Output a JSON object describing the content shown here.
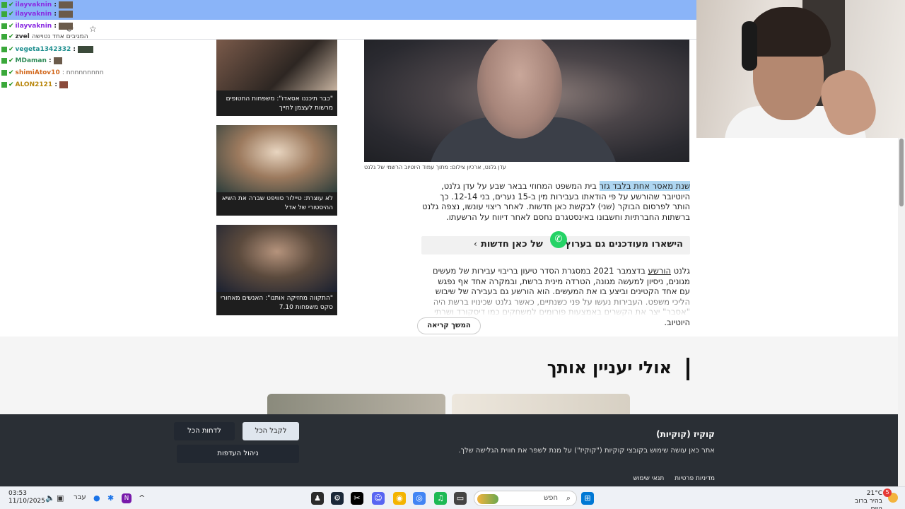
{
  "chat": {
    "messages": [
      {
        "user": "ilayvaknin",
        "text": ":",
        "color": "#8a2be2"
      },
      {
        "user": "ilayvaknin",
        "text": ":",
        "color": "#8a2be2"
      },
      {
        "user": "ilayvaknin",
        "text": ":",
        "color": "#8a2be2"
      },
      {
        "user": "zvel",
        "text": "המגיבים אחד נטוישה",
        "color": "#333333"
      },
      {
        "user": "vegeta1342332",
        "text": ":",
        "color": "#1e8f8f"
      },
      {
        "user": "MDaman",
        "text": ":",
        "color": "#2e8b57"
      },
      {
        "user": "shimiAtov10",
        "text": ": חחחחחחחחח",
        "color": "#d2691e"
      },
      {
        "user": "ALON2121",
        "text": ":",
        "color": "#b8860b"
      }
    ]
  },
  "browser": {
    "star_icon": "star-icon",
    "extensions_icon": "puzzle-icon"
  },
  "sidebar_cards": [
    {
      "caption": "\"כבר תיכננו אסאדו\": משפחות החטופים מרשות לעצמן לחייך"
    },
    {
      "caption": "לא עוצרת: טיילור סוויפט שברה את השיא ההיסטורי של אדל"
    },
    {
      "caption": "\"התקווה מחזיקה אותנו\": האנשים מאחורי סקס משפחות 7.10"
    }
  ],
  "article": {
    "credit": "עדן גלנט, ארכיון צילום: מתוך עמוד היוטיוב הרשמי של גלנט",
    "p1_highlight": "שנת מאסר אחת בלבד גזר",
    "p1_rest": " בית המשפט המחוזי בבאר שבע על עדן גלנט, היוטיובר שהורשע על פי הודאתו בעבירות מין ב-15 נערים, בני 12-14. כך הותר לפרסום הבוקר (שני) לבקשת כאן חדשות. לאחר ריצוי עונשו, נצפה גלנט ברשתות החברתיות וחשבונו באינסטגרם נחסם לאחר דיווח על הרשעתו.",
    "whatsapp_text": "הישארו מעודכנים גם בערוץ",
    "whatsapp_channel": "של כאן חדשות",
    "p2_start": "גלנט ",
    "p2_link": "הורשע",
    "p2_rest": " בדצמבר 2021 במסגרת הסדר טיעון בריבוי עבירות של מעשים מגונים, ניסיון למעשה מגונה, הטרדה מינית ברשת, ובמקרה אחד אף נפגש עם אחד הקטינים וביצע בו את המעשים. הוא הורשע גם בעבירה של שיבוש הליכי משפט. העבירות נעשו על פני כשנתיים, כאשר גלנט שכינויו ברשת היה \"אסבר\" יצר את הקשרים באמצעות פורומים למשחקים כמו דיסקורד ושרתי היוטיוב.",
    "read_more": "המשך קריאה"
  },
  "recommended": {
    "title": "אולי יעניין אותך"
  },
  "cookie_banner": {
    "title": "קוקיז (קוקיות)",
    "text": "אתר כאן עושה שימוש בקובצי קוקיות (\"קוקיז\") על מנת לשפר את חווית הגלישה שלך.",
    "accept_label": "לקבל הכל",
    "reject_label": "לדחות הכל",
    "manage_label": "ניהול העדפות",
    "privacy_label": "מדיניות פרטיות",
    "terms_label": "תנאי שימוש"
  },
  "taskbar": {
    "time": "03:53",
    "date": "11/10/2025",
    "language": "עבר",
    "search_placeholder": "חפש",
    "weather_temp": "21°C",
    "weather_desc": "בהיר ברוב היום",
    "notification_count": "5"
  }
}
